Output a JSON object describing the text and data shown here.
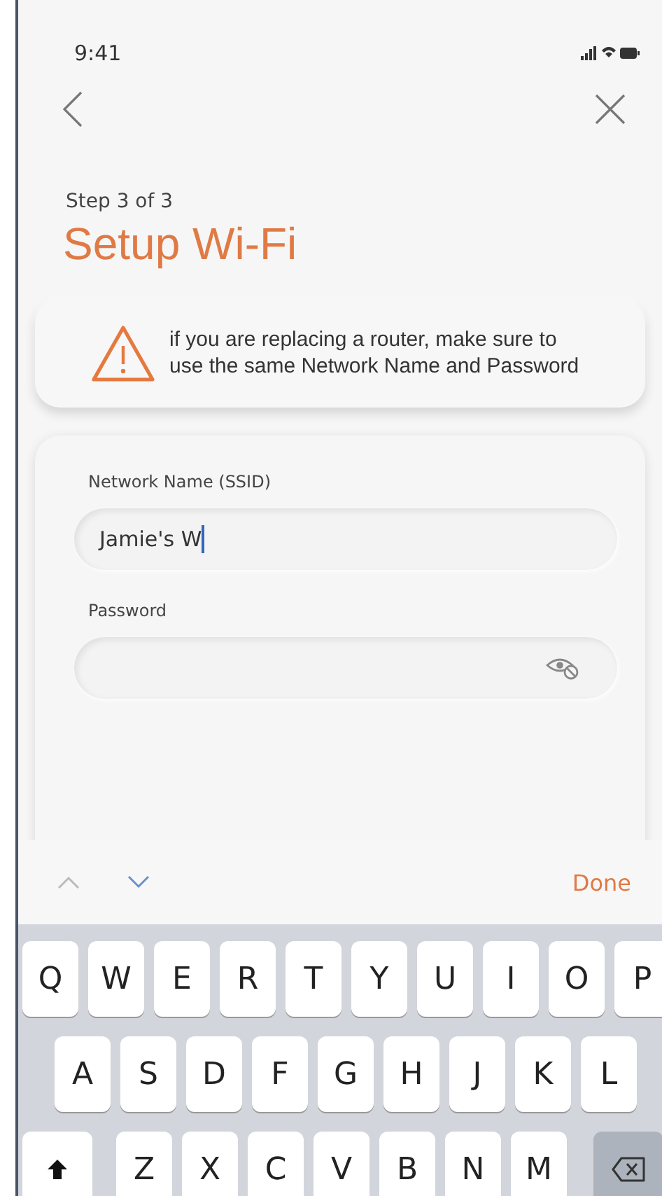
{
  "status_bar": {
    "time": "9:41"
  },
  "header": {
    "step": "Step 3 of 3",
    "title": "Setup Wi-Fi"
  },
  "notice": {
    "text": "if you are replacing a router, make sure to use the same Network Name and Password"
  },
  "form": {
    "fields": [
      {
        "label": "Network Name (SSID)",
        "value": "Jamie's W",
        "focused": true,
        "kind": "text"
      },
      {
        "label": "Password",
        "focused": false,
        "kind": "password"
      }
    ]
  },
  "keyboard_toolbar": {
    "done": "Done"
  },
  "keyboard": {
    "rows": [
      [
        "Q",
        "W",
        "E",
        "R",
        "T",
        "Y",
        "U",
        "I",
        "O",
        "P"
      ],
      [
        "A",
        "S",
        "D",
        "F",
        "G",
        "H",
        "J",
        "K",
        "L"
      ],
      [
        "Z",
        "X",
        "C",
        "V",
        "B",
        "N",
        "M"
      ]
    ]
  }
}
